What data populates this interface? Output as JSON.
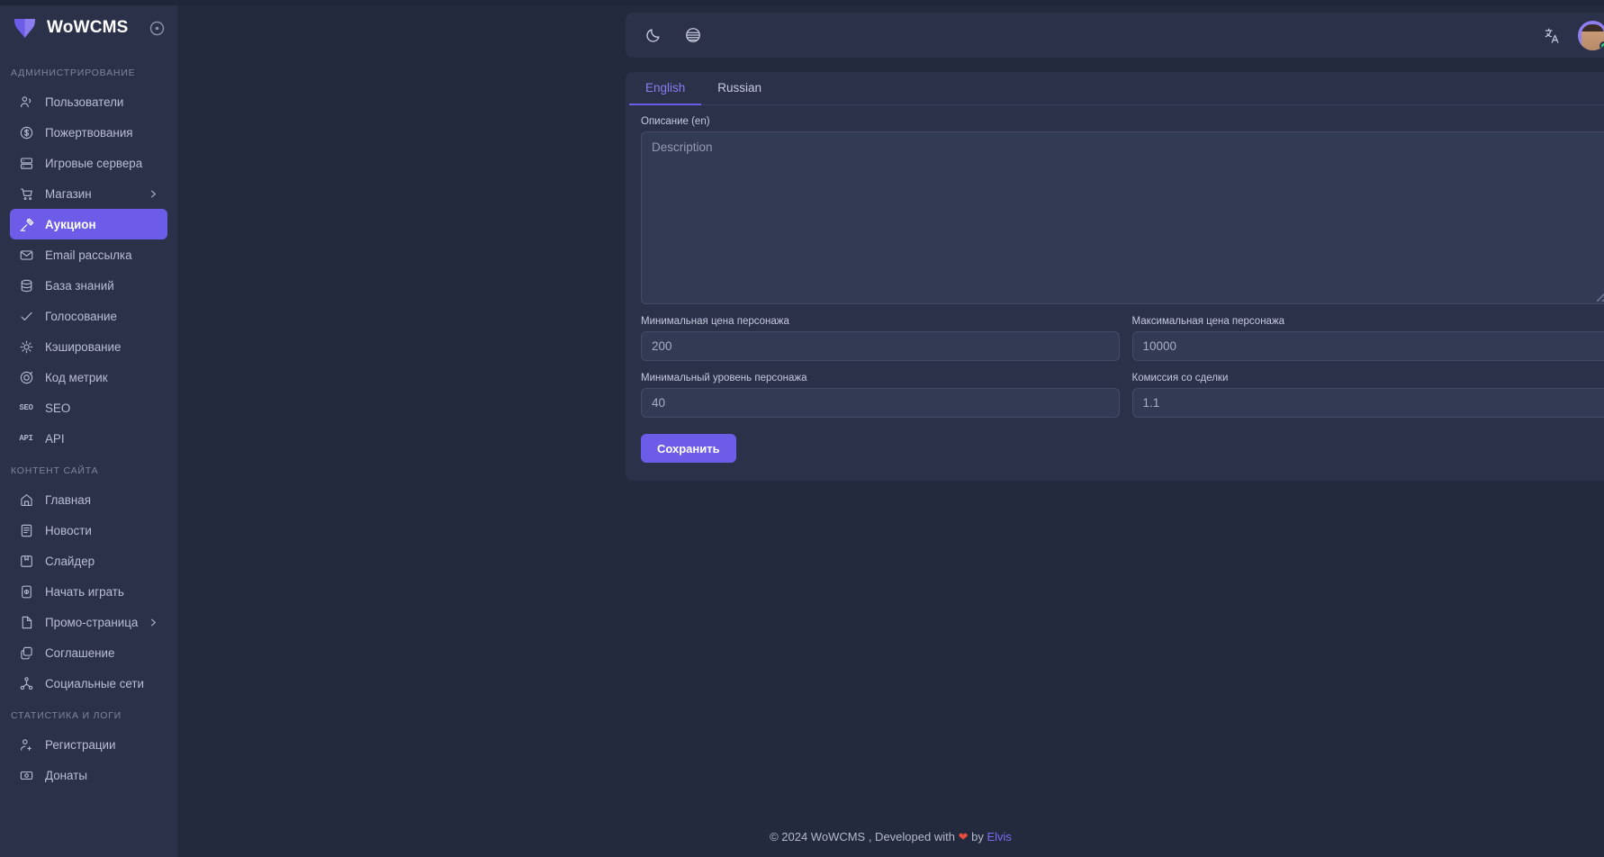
{
  "brand": {
    "name": "WoWCMS",
    "logo_icon": "wow-logo-icon",
    "toggle_icon": "collapse-circle-icon"
  },
  "sidebar": {
    "sections": [
      {
        "title": "АДМИНИСТРИРОВАНИЕ",
        "items": [
          {
            "label": "Пользователи",
            "icon": "users-icon",
            "active": false,
            "chevron": false
          },
          {
            "label": "Пожертвования",
            "icon": "dollar-circle-icon",
            "active": false,
            "chevron": false
          },
          {
            "label": "Игровые сервера",
            "icon": "server-icon",
            "active": false,
            "chevron": false
          },
          {
            "label": "Магазин",
            "icon": "cart-icon",
            "active": false,
            "chevron": true
          },
          {
            "label": "Аукцион",
            "icon": "gavel-icon",
            "active": true,
            "chevron": false
          },
          {
            "label": "Email рассылка",
            "icon": "mail-icon",
            "active": false,
            "chevron": false
          },
          {
            "label": "База знаний",
            "icon": "database-icon",
            "active": false,
            "chevron": false
          },
          {
            "label": "Голосование",
            "icon": "check-icon",
            "active": false,
            "chevron": false
          },
          {
            "label": "Кэширование",
            "icon": "cache-icon",
            "active": false,
            "chevron": false
          },
          {
            "label": "Код метрик",
            "icon": "metrics-icon",
            "active": false,
            "chevron": false
          },
          {
            "label": "SEO",
            "icon": "seo-text-icon",
            "active": false,
            "chevron": false
          },
          {
            "label": "API",
            "icon": "api-text-icon",
            "active": false,
            "chevron": false
          }
        ]
      },
      {
        "title": "КОНТЕНТ САЙТА",
        "items": [
          {
            "label": "Главная",
            "icon": "home-icon",
            "active": false,
            "chevron": false
          },
          {
            "label": "Новости",
            "icon": "news-icon",
            "active": false,
            "chevron": false
          },
          {
            "label": "Слайдер",
            "icon": "slider-icon",
            "active": false,
            "chevron": false
          },
          {
            "label": "Начать играть",
            "icon": "play-card-icon",
            "active": false,
            "chevron": false
          },
          {
            "label": "Промо-страница",
            "icon": "page-icon",
            "active": false,
            "chevron": true
          },
          {
            "label": "Соглашение",
            "icon": "copy-icon",
            "active": false,
            "chevron": false
          },
          {
            "label": "Социальные сети",
            "icon": "share-network-icon",
            "active": false,
            "chevron": false
          }
        ]
      },
      {
        "title": "СТАТИСТИКА И ЛОГИ",
        "items": [
          {
            "label": "Регистрации",
            "icon": "user-plus-icon",
            "active": false,
            "chevron": false
          },
          {
            "label": "Донаты",
            "icon": "donate-box-icon",
            "active": false,
            "chevron": false
          }
        ]
      }
    ]
  },
  "topbar": {
    "theme_icon": "moon-icon",
    "contrast_icon": "contrast-globe-icon",
    "language_icon": "translate-icon",
    "avatar": "user-avatar",
    "status": "online"
  },
  "card": {
    "tabs": [
      {
        "label": "English",
        "active": true
      },
      {
        "label": "Russian",
        "active": false
      }
    ],
    "description": {
      "label": "Описание (en)",
      "placeholder": "Description",
      "value": ""
    },
    "fields": [
      {
        "label": "Минимальная цена персонажа",
        "value": "200",
        "name": "min-character-price"
      },
      {
        "label": "Максимальная цена персонажа",
        "value": "10000",
        "name": "max-character-price"
      },
      {
        "label": "Минимальный уровень персонажа",
        "value": "40",
        "name": "min-character-level"
      },
      {
        "label": "Комиссия со сделки",
        "value": "1.1",
        "name": "deal-commission"
      }
    ],
    "save_label": "Сохранить"
  },
  "footer": {
    "prefix": "© 2024 WoWCMS , Developed with",
    "heart": "❤",
    "by": "by",
    "author": "Elvis"
  },
  "colors": {
    "accent": "#6c5ce7",
    "sidebar_bg": "#2b3149",
    "page_bg": "#242a3d",
    "input_bg": "#333a54",
    "heart": "#e74c3c",
    "online": "#2ecc71"
  }
}
